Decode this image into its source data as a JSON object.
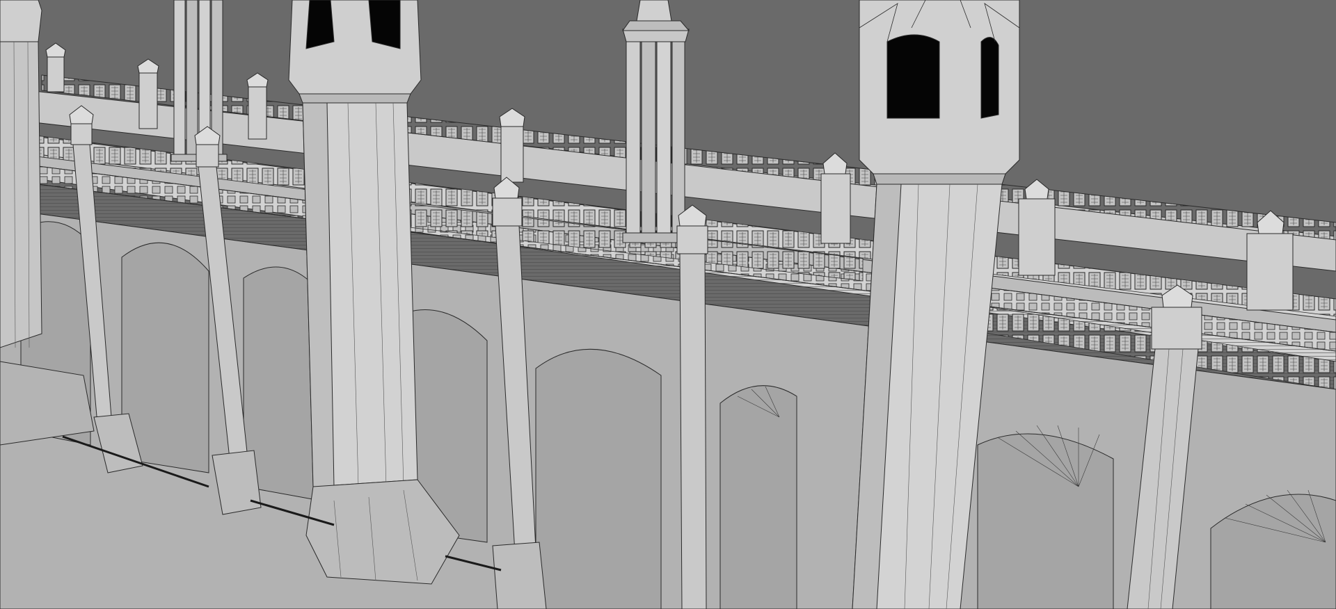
{
  "viewport": {
    "background_color": "#6a6a6a",
    "mesh_fill_light": "#d6d6d6",
    "mesh_fill_mid": "#bcbcbc",
    "mesh_fill_dark": "#9c9c9c",
    "wire_color": "#2a2a2a",
    "void_color": "#050505"
  },
  "scene": {
    "subject": "bridge-model",
    "display_mode": "wireframe-on-shaded",
    "tower_count": 3,
    "spire_count": 7,
    "arch_count": 7
  }
}
